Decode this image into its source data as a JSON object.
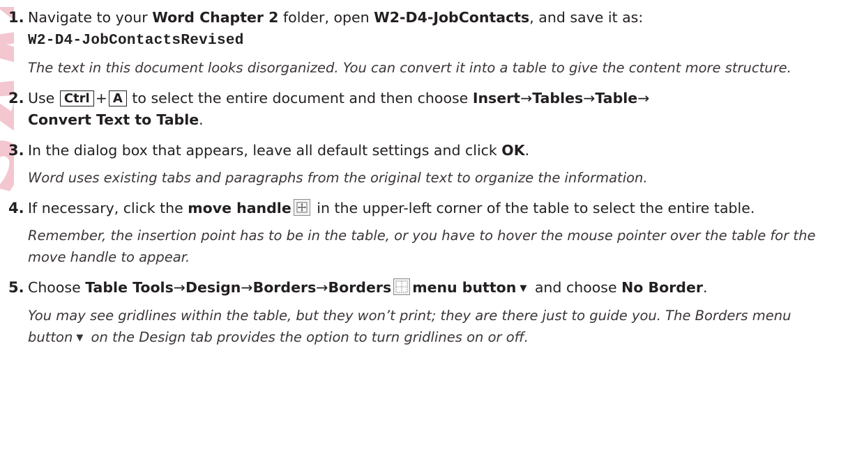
{
  "watermark": {
    "text": "SAMPLE"
  },
  "steps": {
    "s1": {
      "num": "1.",
      "a": "Navigate to your ",
      "b": "Word Chapter 2",
      "c": " folder, open ",
      "d": "W2-D4-JobContacts",
      "e": ", and save it as:",
      "filename": "W2-D4-JobContactsRevised",
      "note": "The text in this document looks disorganized. You can convert it into a table to give the content more structure."
    },
    "s2": {
      "num": "2.",
      "a": "Use ",
      "key1": "Ctrl",
      "plus": "+",
      "key2": "A",
      "b": " to select the entire document and then choose ",
      "insert": "Insert",
      "tables": "Tables",
      "table": "Table",
      "convert": "Convert Text to Table",
      "end": "."
    },
    "s3": {
      "num": "3.",
      "a": "In the dialog box that appears, leave all default settings and click ",
      "ok": "OK",
      "end": ".",
      "note": "Word uses existing tabs and paragraphs from the original text to organize the information."
    },
    "s4": {
      "num": "4.",
      "a": "If necessary, click the ",
      "handle": "move handle",
      "b": " in the upper-left corner of the table to select the entire table.",
      "note": "Remember, the insertion point has to be in the table, or you have to hover the mouse pointer over the table for the move handle to appear."
    },
    "s5": {
      "num": "5.",
      "a": "Choose ",
      "tt": "Table Tools",
      "design": "Design",
      "borders": "Borders",
      "borders2": "Borders",
      "menu": "menu button",
      "b": " and choose ",
      "noborder": "No Border",
      "end": ".",
      "note1": "You may see gridlines within the table, but they won’t print; they are there just to guide you. The Borders menu button",
      "note2": " on the Design tab provides the option to turn gridlines on or off."
    }
  },
  "glyphs": {
    "arrow": "→",
    "caret": "▼"
  },
  "icons": {
    "move": "move-handle-icon",
    "borders": "borders-icon"
  }
}
